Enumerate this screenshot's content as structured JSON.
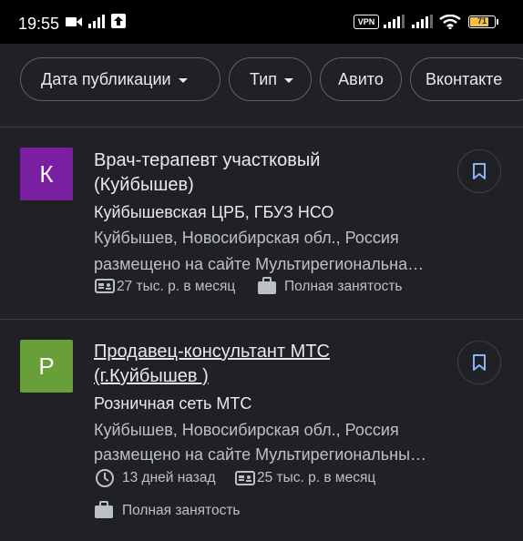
{
  "status_bar": {
    "time": "19:55",
    "vpn": "VPN",
    "battery_percent": "71",
    "battery_color": "#f6c445"
  },
  "filters": [
    {
      "label": "Дата публикации",
      "dropdown": true
    },
    {
      "label": "Тип",
      "dropdown": true
    },
    {
      "label": "Авито",
      "dropdown": false
    },
    {
      "label": "Вконтакте",
      "dropdown": false
    }
  ],
  "jobs": [
    {
      "avatar_letter": "К",
      "avatar_color": "#7b1fa2",
      "title_line1": "Врач-терапевт участковый",
      "title_line2": "(Куйбышев)",
      "company": "Куйбышевская ЦРБ, ГБУЗ НСО",
      "location": "Куйбышев, Новосибирская обл., Россия",
      "source": "размещено на сайте Мультирегиональна…",
      "salary": "27 тыс. р. в месяц",
      "employment": "Полная занятость"
    },
    {
      "avatar_letter": "Р",
      "avatar_color": "#689f38",
      "title_line1": "Продавец-консультант МТС",
      "title_line2": "(г.Куйбышев )",
      "company": "Розничная сеть МТС",
      "location": "Куйбышев, Новосибирская обл., Россия",
      "source": "размещено на сайте Мультирегиональны…",
      "posted": "13 дней назад",
      "salary": "25 тыс. р. в месяц",
      "employment": "Полная занятость"
    }
  ]
}
